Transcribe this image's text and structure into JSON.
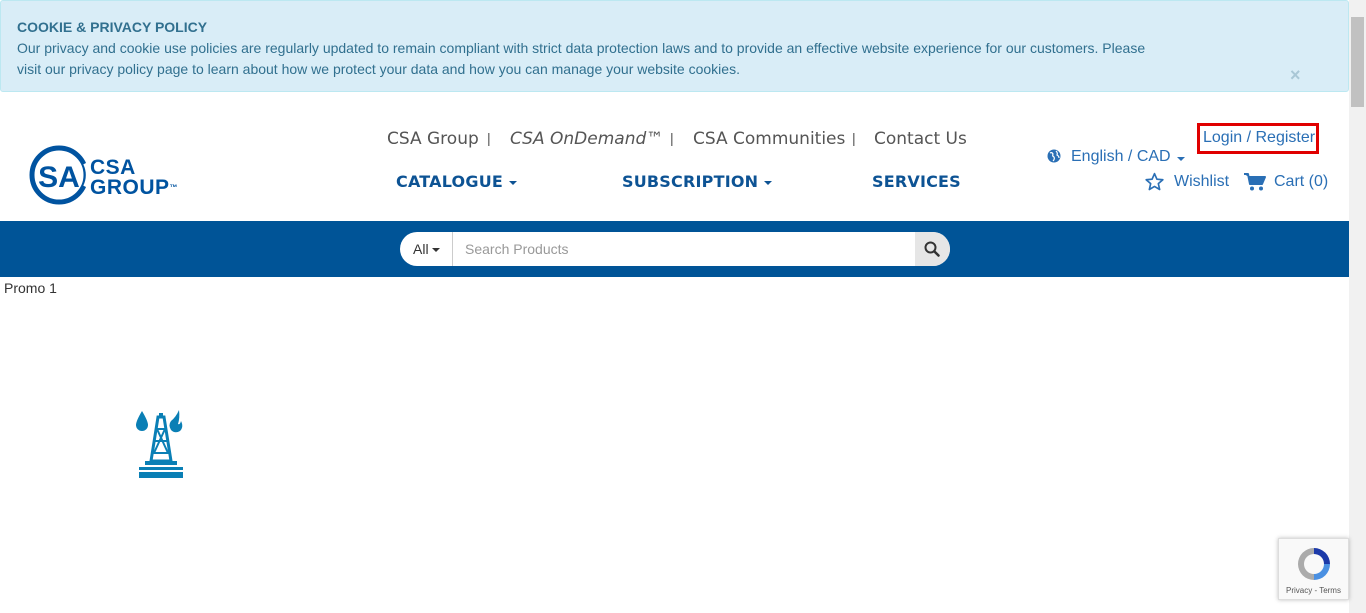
{
  "cookie_banner": {
    "title": "COOKIE & PRIVACY POLICY",
    "text": "Our privacy and cookie use policies are regularly updated to remain compliant with strict data protection laws and to provide an effective website experience for our customers. Please visit our privacy policy page to learn about how we protect your data and how you can manage your website cookies.",
    "close": "×"
  },
  "logo": {
    "line1": "CSA",
    "line2": "GROUP",
    "tm": "™"
  },
  "top_links": [
    "CSA Group",
    "CSA OnDemand™",
    "CSA Communities",
    "Contact Us"
  ],
  "separator": "|",
  "main_nav": {
    "catalogue": "CATALOGUE",
    "subscription": "SUBSCRIPTION",
    "services": "SERVICES"
  },
  "language": "English / CAD",
  "login": "Login / Register",
  "wishlist": "Wishlist",
  "cart": "Cart (0)",
  "search": {
    "category": "All",
    "placeholder": "Search Products"
  },
  "promo_alt": "Promo 1",
  "recaptcha": {
    "links": "Privacy - Terms"
  },
  "colors": {
    "brand_blue": "#005497",
    "link_blue": "#2a6fb5",
    "highlight_red": "#e00000",
    "banner_bg": "#d9edf7"
  }
}
